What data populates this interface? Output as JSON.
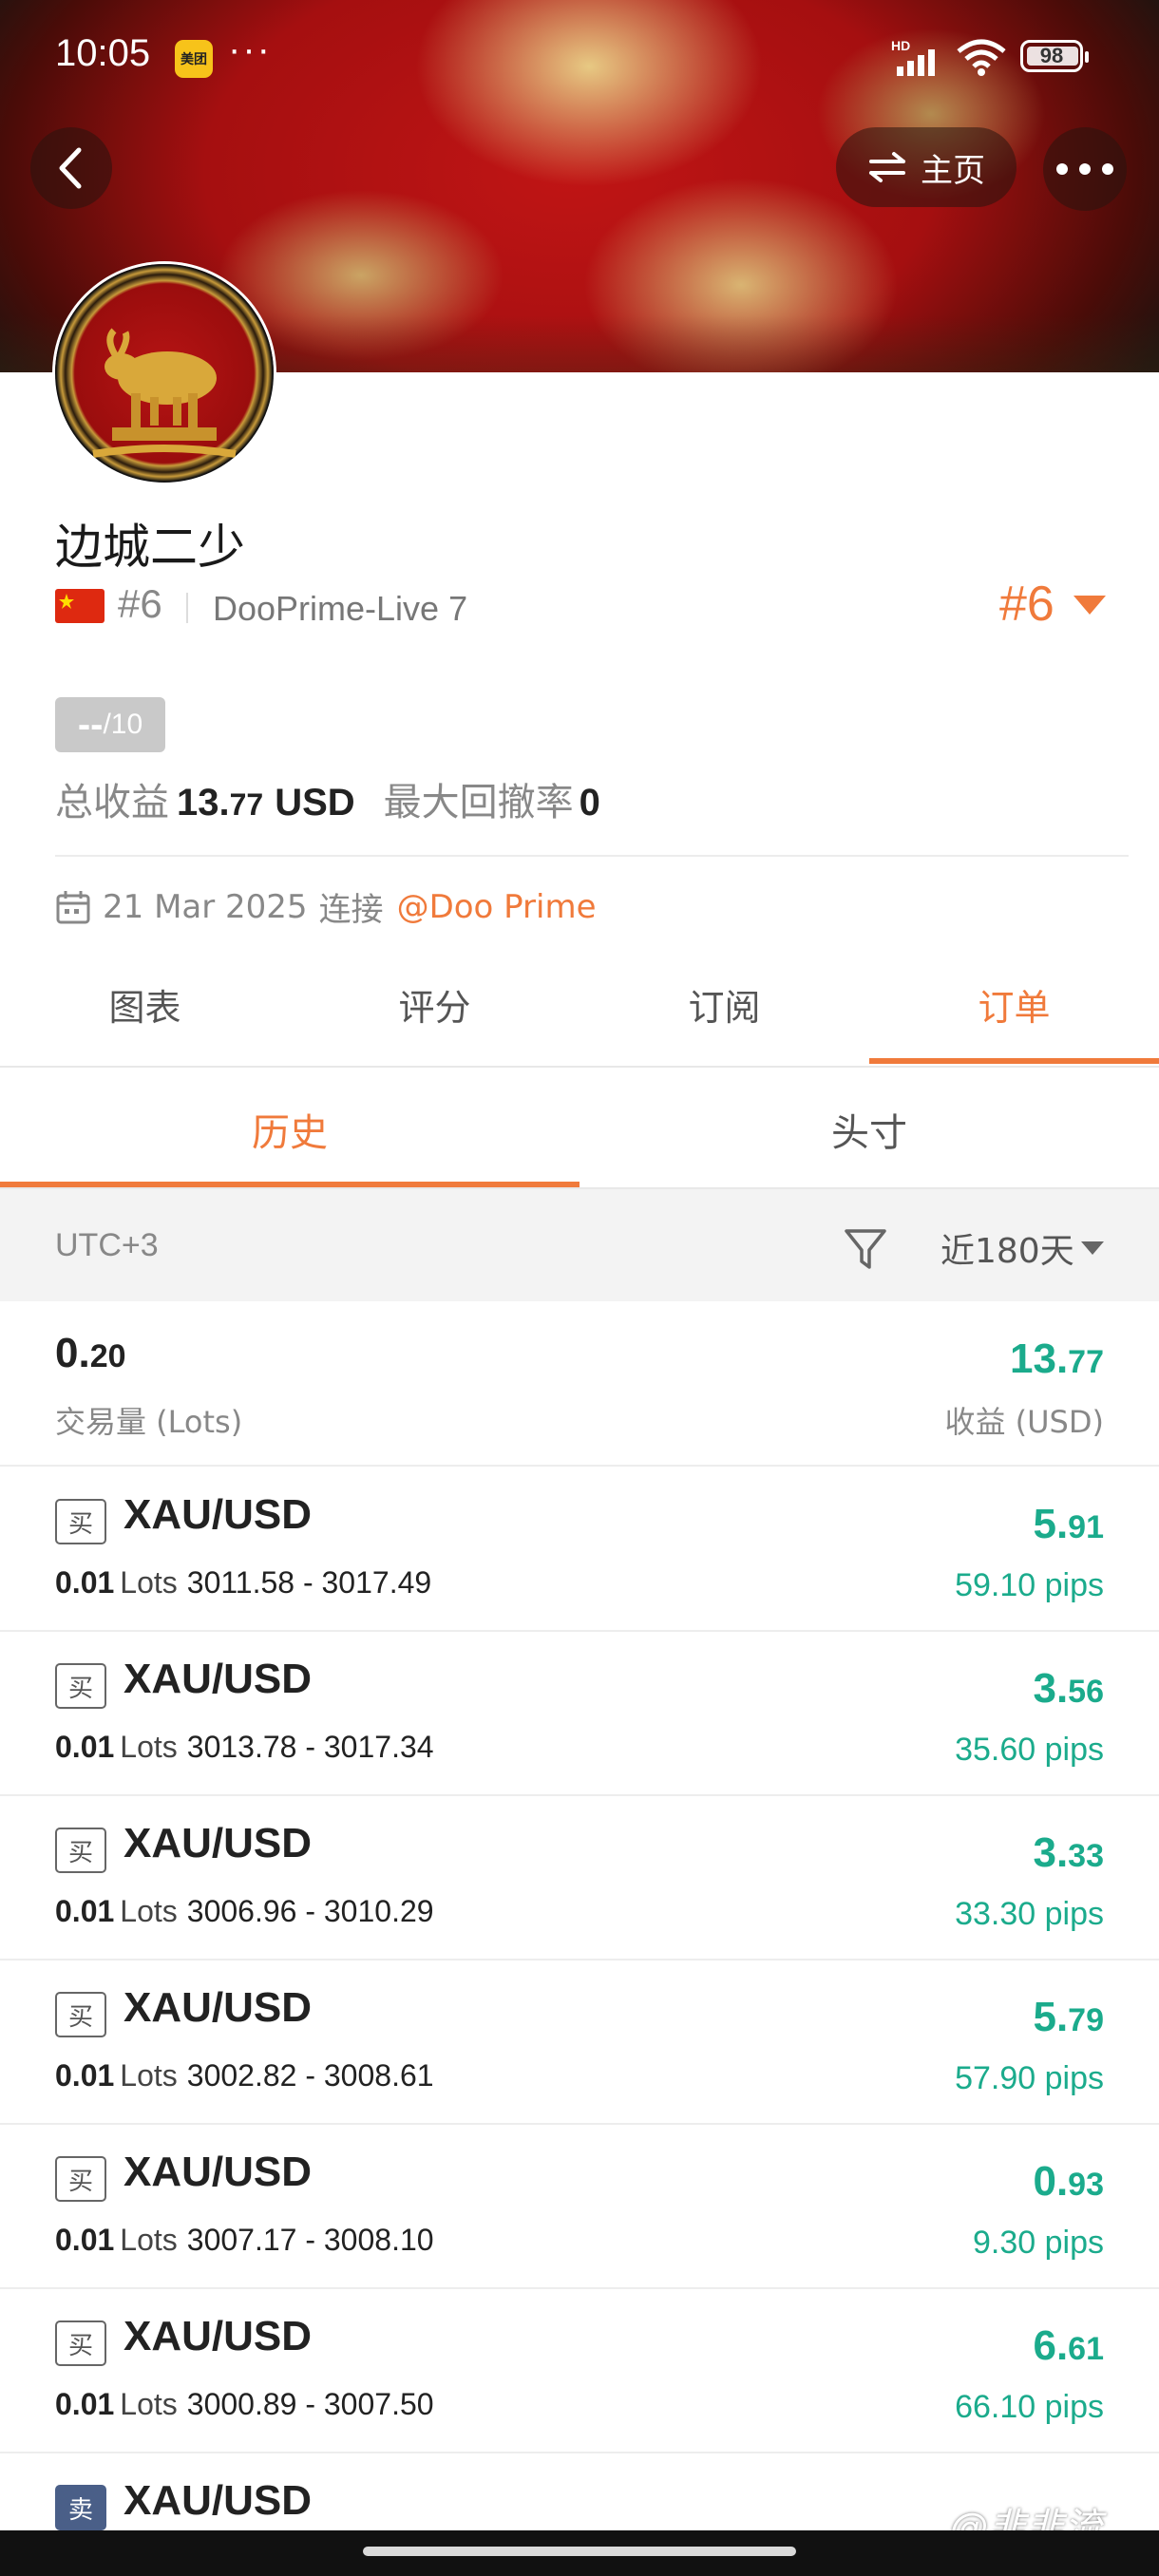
{
  "status_bar": {
    "time": "10:05",
    "app_badge": "美团",
    "more": "···",
    "network": "HD",
    "battery": "98"
  },
  "header": {
    "home_label": "主页"
  },
  "profile": {
    "name": "边城二少",
    "rank_small": "#6",
    "broker": "DooPrime-Live 7",
    "rank_big": "#6",
    "score_value": "--",
    "score_total": "/10",
    "total_profit_label": "总收益",
    "total_profit_int": "13.",
    "total_profit_dec": "77",
    "total_profit_unit": "USD",
    "max_drawdown_label": "最大回撤率",
    "max_drawdown_value": "0",
    "connected_date": "21 Mar 2025",
    "connected_label": "连接",
    "connected_link": "@Doo Prime"
  },
  "tabs": [
    {
      "label": "图表",
      "active": false
    },
    {
      "label": "评分",
      "active": false
    },
    {
      "label": "订阅",
      "active": false
    },
    {
      "label": "订单",
      "active": true
    }
  ],
  "subtabs": [
    {
      "label": "历史",
      "active": true
    },
    {
      "label": "头寸",
      "active": false
    }
  ],
  "filter": {
    "timezone": "UTC+3",
    "period": "近180天"
  },
  "summary": {
    "lots_int": "0.",
    "lots_dec": "20",
    "lots_label": "交易量 (Lots)",
    "profit_int": "13.",
    "profit_dec": "77",
    "profit_label": "收益 (USD)"
  },
  "orders": [
    {
      "side": "买",
      "symbol": "XAU/USD",
      "lots": "0.01",
      "lots_word": "Lots",
      "range": "3011.58 - 3017.49",
      "profit_int": "5.",
      "profit_dec": "91",
      "pips": "59.10 pips"
    },
    {
      "side": "买",
      "symbol": "XAU/USD",
      "lots": "0.01",
      "lots_word": "Lots",
      "range": "3013.78 - 3017.34",
      "profit_int": "3.",
      "profit_dec": "56",
      "pips": "35.60 pips"
    },
    {
      "side": "买",
      "symbol": "XAU/USD",
      "lots": "0.01",
      "lots_word": "Lots",
      "range": "3006.96 - 3010.29",
      "profit_int": "3.",
      "profit_dec": "33",
      "pips": "33.30 pips"
    },
    {
      "side": "买",
      "symbol": "XAU/USD",
      "lots": "0.01",
      "lots_word": "Lots",
      "range": "3002.82 - 3008.61",
      "profit_int": "5.",
      "profit_dec": "79",
      "pips": "57.90 pips"
    },
    {
      "side": "买",
      "symbol": "XAU/USD",
      "lots": "0.01",
      "lots_word": "Lots",
      "range": "3007.17 - 3008.10",
      "profit_int": "0.",
      "profit_dec": "93",
      "pips": "9.30 pips"
    },
    {
      "side": "买",
      "symbol": "XAU/USD",
      "lots": "0.01",
      "lots_word": "Lots",
      "range": "3000.89 - 3007.50",
      "profit_int": "6.",
      "profit_dec": "61",
      "pips": "66.10 pips"
    },
    {
      "side": "卖",
      "symbol": "XAU/USD"
    }
  ],
  "watermark": "@韭韭流",
  "colors": {
    "accent": "#f07a3b",
    "profit": "#1bab8c",
    "sell_tag": "#4a5f88"
  }
}
